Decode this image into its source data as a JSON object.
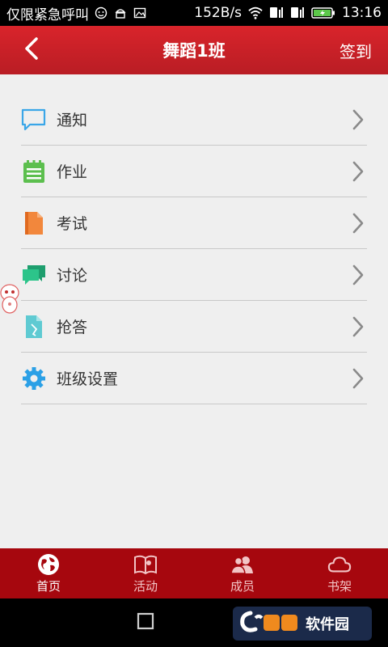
{
  "status_bar": {
    "carrier_text": "仅限紧急呼叫",
    "speed": "152B/s",
    "time": "13:16"
  },
  "header": {
    "title": "舞蹈1班",
    "action_label": "签到"
  },
  "menu": {
    "items": [
      {
        "label": "通知",
        "icon": "chat-bubble-icon"
      },
      {
        "label": "作业",
        "icon": "notepad-icon"
      },
      {
        "label": "考试",
        "icon": "document-icon"
      },
      {
        "label": "讨论",
        "icon": "discussion-icon"
      },
      {
        "label": "抢答",
        "icon": "quiz-doc-icon"
      },
      {
        "label": "班级设置",
        "icon": "gear-icon"
      }
    ]
  },
  "bottom_nav": {
    "items": [
      {
        "label": "首页",
        "icon": "globe-icon",
        "active": true
      },
      {
        "label": "活动",
        "icon": "book-icon",
        "active": false
      },
      {
        "label": "成员",
        "icon": "members-icon",
        "active": false
      },
      {
        "label": "书架",
        "icon": "cloud-icon",
        "active": false
      }
    ]
  },
  "watermark": {
    "text": "软件园"
  },
  "colors": {
    "header_red": "#d9242b",
    "nav_red": "#a6070e",
    "content_bg": "#efefef"
  }
}
